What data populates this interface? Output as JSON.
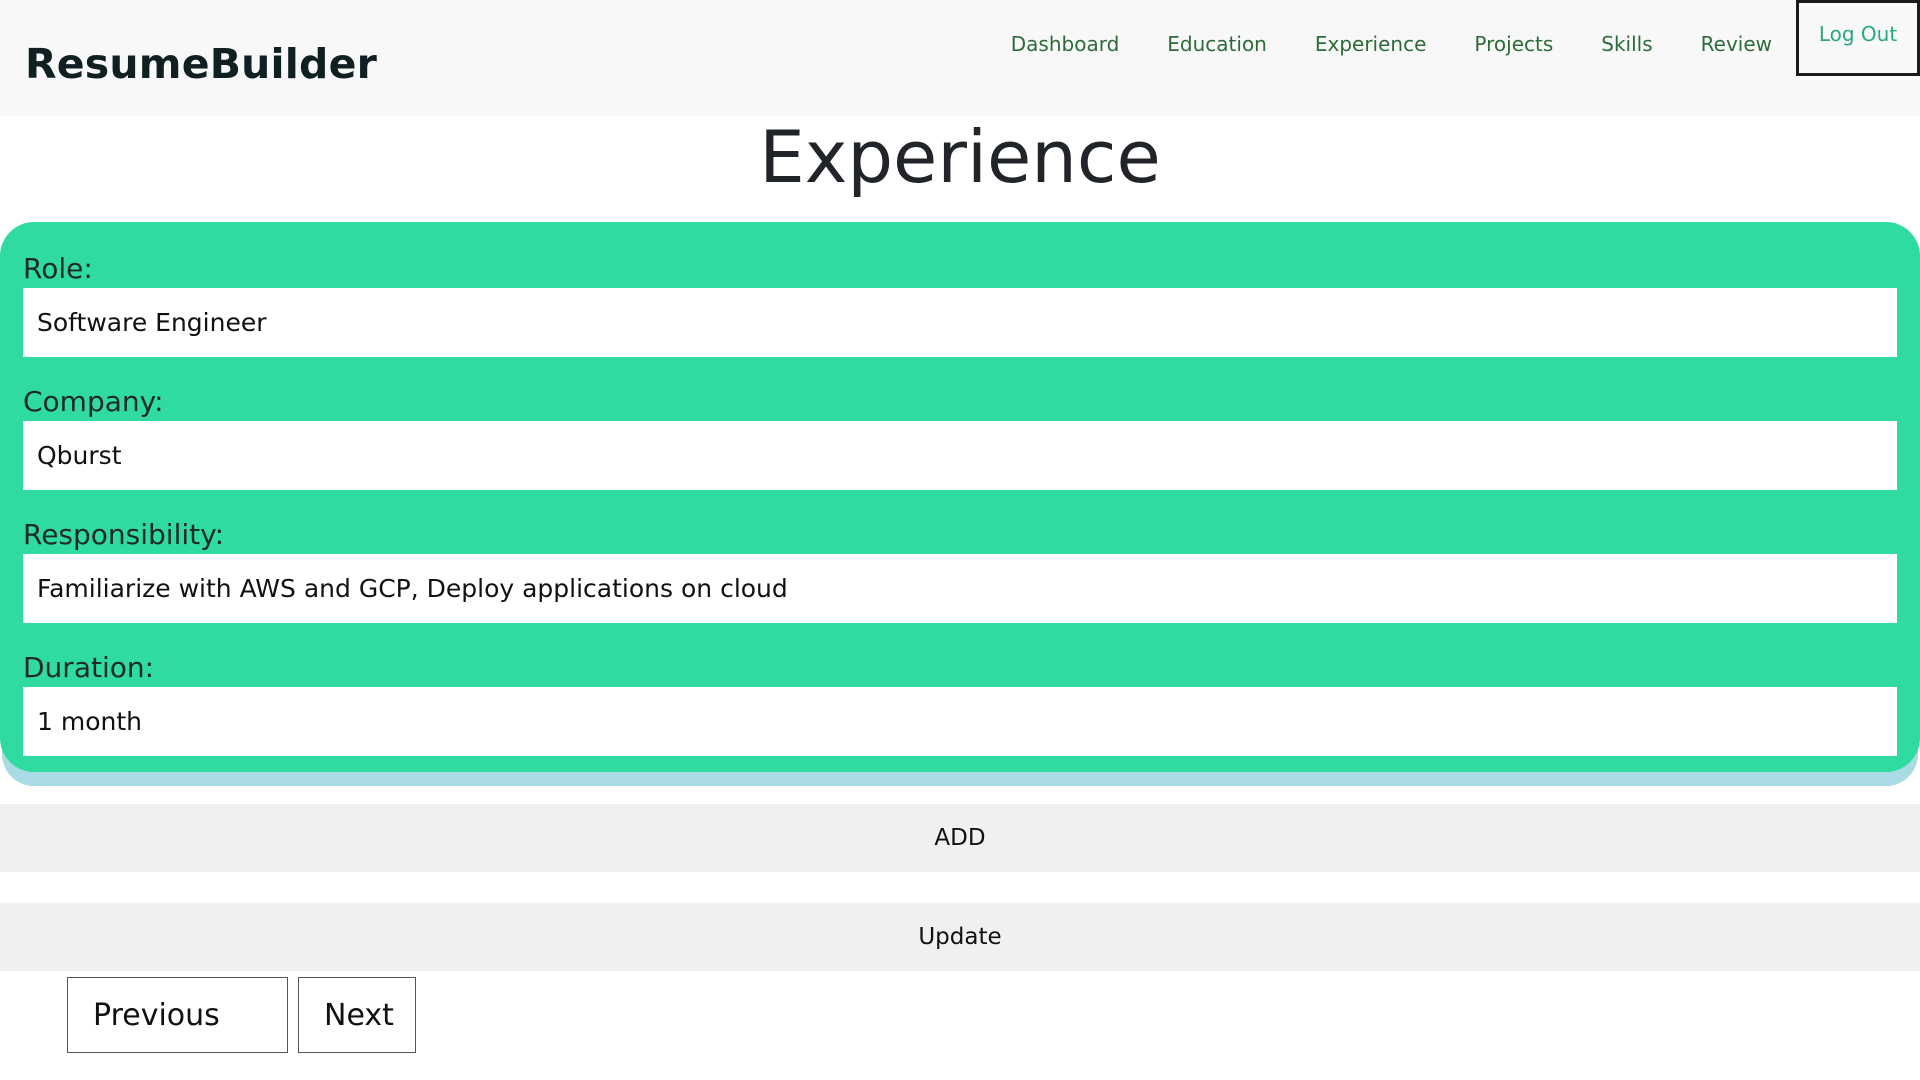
{
  "brand": "ResumeBuilder",
  "nav": {
    "items": [
      {
        "label": "Dashboard"
      },
      {
        "label": "Education"
      },
      {
        "label": "Experience"
      },
      {
        "label": "Projects"
      },
      {
        "label": "Skills"
      },
      {
        "label": "Review"
      }
    ],
    "logout_label": "Log Out"
  },
  "page_title": "Experience",
  "form": {
    "role": {
      "label": "Role:",
      "value": "Software Engineer"
    },
    "company": {
      "label": "Company:",
      "value": "Qburst"
    },
    "responsibility": {
      "label": "Responsibility:",
      "value": "Familiarize with AWS and GCP, Deploy applications on cloud"
    },
    "duration": {
      "label": "Duration:",
      "value": "1 month"
    }
  },
  "actions": {
    "add_label": "ADD",
    "update_label": "Update",
    "previous_label": "Previous",
    "next_label": "Next"
  },
  "colors": {
    "card_bg": "#2fdba1",
    "nav_link": "#2d6b38",
    "logout": "#2ca880"
  }
}
